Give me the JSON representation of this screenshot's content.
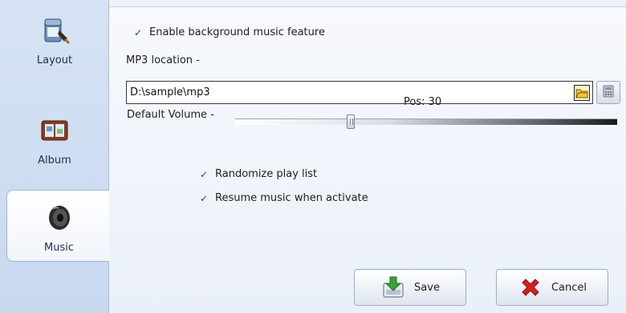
{
  "sidebar": {
    "items": [
      {
        "label": "Layout",
        "icon": "paint-bucket-icon"
      },
      {
        "label": "Album",
        "icon": "photo-album-icon"
      },
      {
        "label": "Music",
        "icon": "speaker-icon",
        "active": true
      }
    ]
  },
  "music": {
    "enable_label": "Enable background music feature",
    "enable_checked": true,
    "mp3_location_label": "MP3 location -",
    "mp3_path": "D:\\sample\\mp3",
    "volume_label": "Default Volume -",
    "volume_pos_text": "Pos: 30",
    "volume_value": 30,
    "randomize_label": "Randomize play list",
    "randomize_checked": true,
    "resume_label": "Resume music when activate",
    "resume_checked": true
  },
  "buttons": {
    "save_label": "Save",
    "save_mnemonic": "v",
    "cancel_label": "Cancel",
    "cancel_mnemonic": "C"
  },
  "colors": {
    "sidebar_bg": "#c8d8ef",
    "panel_bg": "#eef3fa",
    "cancel_icon": "#d62020",
    "save_icon": "#2e8b2e"
  }
}
